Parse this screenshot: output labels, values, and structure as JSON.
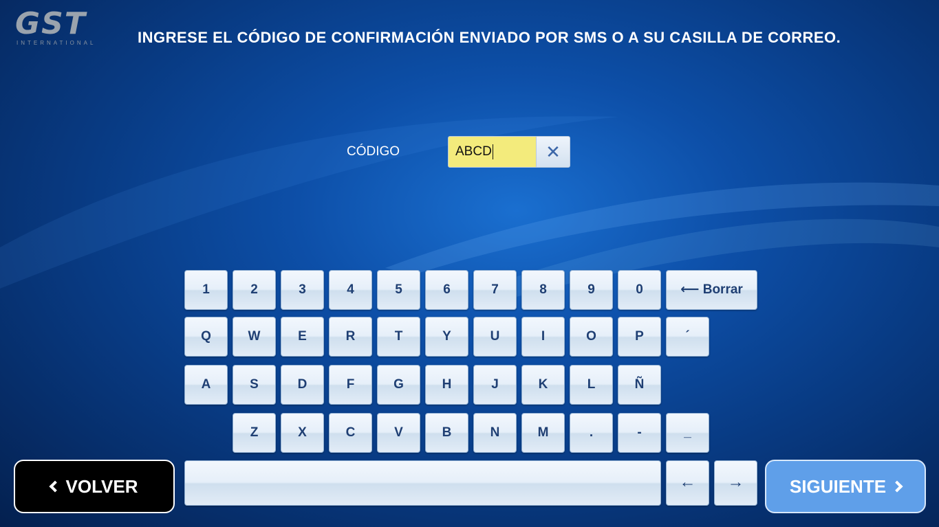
{
  "header": {
    "logo_main": "GST",
    "logo_sub": "INTERNATIONAL",
    "title": "INGRESE EL CÓDIGO DE CONFIRMACIÓN ENVIADO POR SMS O A SU CASILLA DE CORREO."
  },
  "form": {
    "code_label": "CÓDIGO",
    "code_value": "ABCD",
    "clear_glyph": "✕",
    "input_color": "#f3eb7c"
  },
  "keyboard": {
    "row1": [
      "1",
      "2",
      "3",
      "4",
      "5",
      "6",
      "7",
      "8",
      "9",
      "0"
    ],
    "backspace_label": "⟵ Borrar",
    "row2": [
      "Q",
      "W",
      "E",
      "R",
      "T",
      "Y",
      "U",
      "I",
      "O",
      "P",
      "´"
    ],
    "row3": [
      "A",
      "S",
      "D",
      "F",
      "G",
      "H",
      "J",
      "K",
      "L",
      "Ñ"
    ],
    "row4": [
      "Z",
      "X",
      "C",
      "V",
      "B",
      "N",
      "M",
      ".",
      "-",
      "_"
    ],
    "left_arrow": "←",
    "right_arrow": "→"
  },
  "footer": {
    "back_label": "VOLVER",
    "next_label": "SIGUIENTE",
    "next_color": "#5f9fe9"
  }
}
